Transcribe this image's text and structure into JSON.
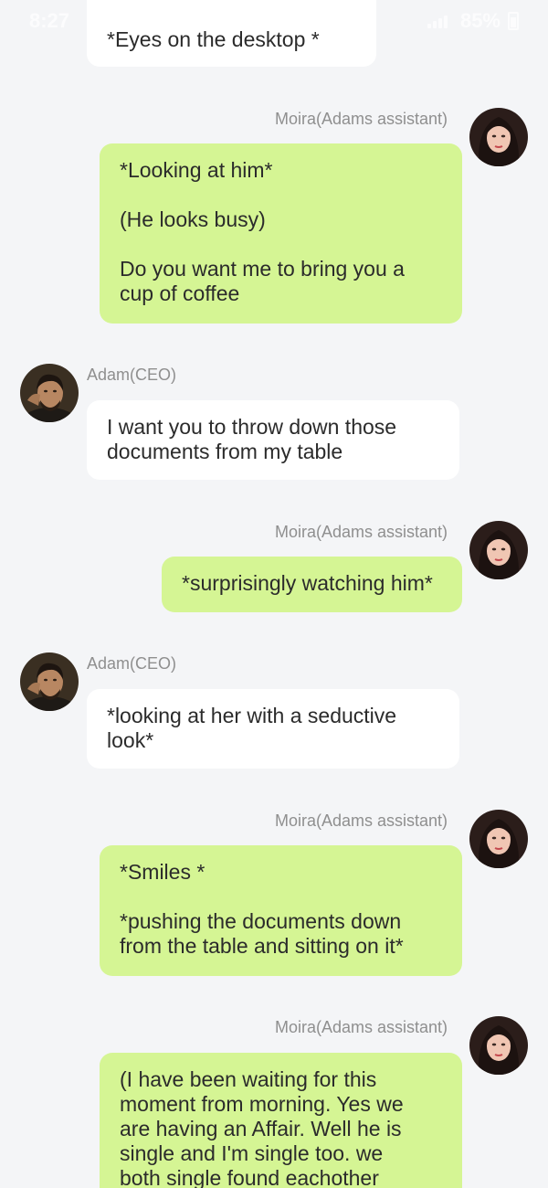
{
  "status_bar": {
    "time": "8:27",
    "battery": "85%"
  },
  "contacts": {
    "assistant": "Moira(Adams assistant)",
    "ceo": "Adam(CEO)"
  },
  "messages": [
    {
      "from": "ceo",
      "lines": [
        "*Eyes on the desktop *"
      ]
    },
    {
      "from": "assistant",
      "lines": [
        "*Looking at him*",
        "",
        "(He looks busy)",
        "",
        "Do you want me to bring you a",
        "cup of coffee"
      ]
    },
    {
      "from": "ceo",
      "lines": [
        "I want you to throw down those",
        "documents from my table"
      ]
    },
    {
      "from": "assistant",
      "lines": [
        "*surprisingly watching him*"
      ]
    },
    {
      "from": "ceo",
      "lines": [
        "*looking at her with a seductive",
        "look*"
      ]
    },
    {
      "from": "assistant",
      "lines": [
        "*Smiles *",
        "",
        "*pushing the documents down",
        "from the table and sitting on it*"
      ]
    },
    {
      "from": "assistant",
      "lines": [
        "(I have been waiting for this",
        "moment from morning. Yes we",
        "are having an Affair. Well he is",
        "single and I'm single too. we",
        "both single found eachother"
      ]
    }
  ],
  "colors": {
    "incoming_bubble": "#ffffff",
    "outgoing_bubble": "#d5f594",
    "background": "#f4f5f7",
    "name_text": "#8f8f8f"
  },
  "icons": {
    "assistant_avatar": "woman-portrait-avatar",
    "ceo_avatar": "man-portrait-avatar"
  }
}
